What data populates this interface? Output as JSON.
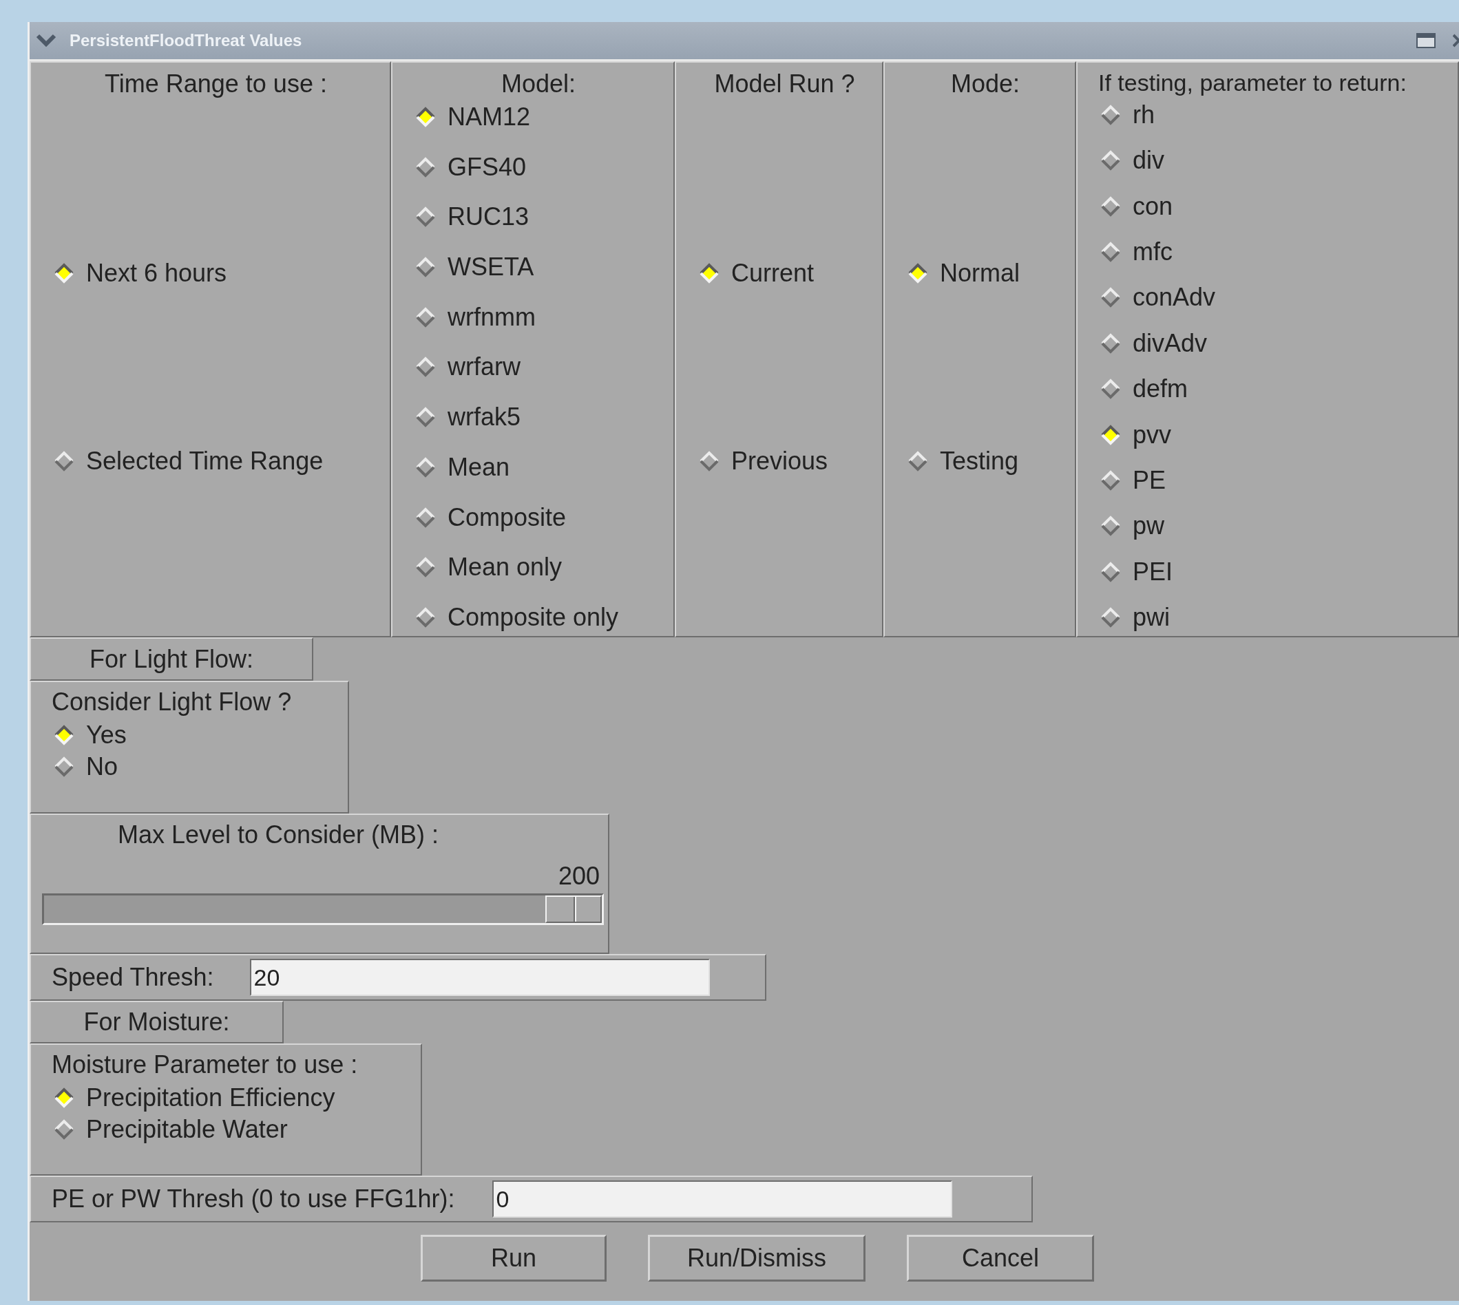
{
  "window": {
    "title": "PersistentFloodThreat Values"
  },
  "top_groups": [
    {
      "label": "Time Range to use :",
      "options": [
        {
          "label": "Next 6 hours",
          "selected": true
        },
        {
          "label": "Selected Time Range",
          "selected": false
        }
      ]
    },
    {
      "label": "Model:",
      "options": [
        {
          "label": "NAM12",
          "selected": true
        },
        {
          "label": "GFS40",
          "selected": false
        },
        {
          "label": "RUC13",
          "selected": false
        },
        {
          "label": "WSETA",
          "selected": false
        },
        {
          "label": "wrfnmm",
          "selected": false
        },
        {
          "label": "wrfarw",
          "selected": false
        },
        {
          "label": "wrfak5",
          "selected": false
        },
        {
          "label": "Mean",
          "selected": false
        },
        {
          "label": "Composite",
          "selected": false
        },
        {
          "label": "Mean only",
          "selected": false
        },
        {
          "label": "Composite only",
          "selected": false
        }
      ]
    },
    {
      "label": "Model Run ?",
      "options": [
        {
          "label": "Current",
          "selected": true
        },
        {
          "label": "Previous",
          "selected": false
        }
      ]
    },
    {
      "label": "Mode:",
      "options": [
        {
          "label": "Normal",
          "selected": true
        },
        {
          "label": "Testing",
          "selected": false
        }
      ]
    },
    {
      "label": "If testing, parameter to return:",
      "options": [
        {
          "label": "rh",
          "selected": false
        },
        {
          "label": "div",
          "selected": false
        },
        {
          "label": "con",
          "selected": false
        },
        {
          "label": "mfc",
          "selected": false
        },
        {
          "label": "conAdv",
          "selected": false
        },
        {
          "label": "divAdv",
          "selected": false
        },
        {
          "label": "defm",
          "selected": false
        },
        {
          "label": "pvv",
          "selected": true
        },
        {
          "label": "PE",
          "selected": false
        },
        {
          "label": "pw",
          "selected": false
        },
        {
          "label": "PEI",
          "selected": false
        },
        {
          "label": "pwi",
          "selected": false
        }
      ]
    }
  ],
  "light_flow": {
    "header": "For Light Flow:",
    "group": {
      "label": "Consider Light Flow ?",
      "options": [
        {
          "label": "Yes",
          "selected": true
        },
        {
          "label": "No",
          "selected": false
        }
      ]
    }
  },
  "max_level": {
    "label": "Max Level to Consider (MB) :",
    "reading": "200",
    "level": 1
  },
  "speed_thresh": {
    "label": "Speed Thresh:",
    "value": "20"
  },
  "moisture": {
    "header": "For Moisture:",
    "group": {
      "label": "Moisture Parameter to use :",
      "options": [
        {
          "label": "Precipitation Efficiency",
          "selected": true
        },
        {
          "label": "Precipitable Water",
          "selected": false
        }
      ]
    }
  },
  "pe_thresh": {
    "label": "PE or PW Thresh (0 to use FFG1hr):",
    "value": "0"
  },
  "buttons": [
    "Run",
    "Run/Dismiss",
    "Cancel"
  ]
}
